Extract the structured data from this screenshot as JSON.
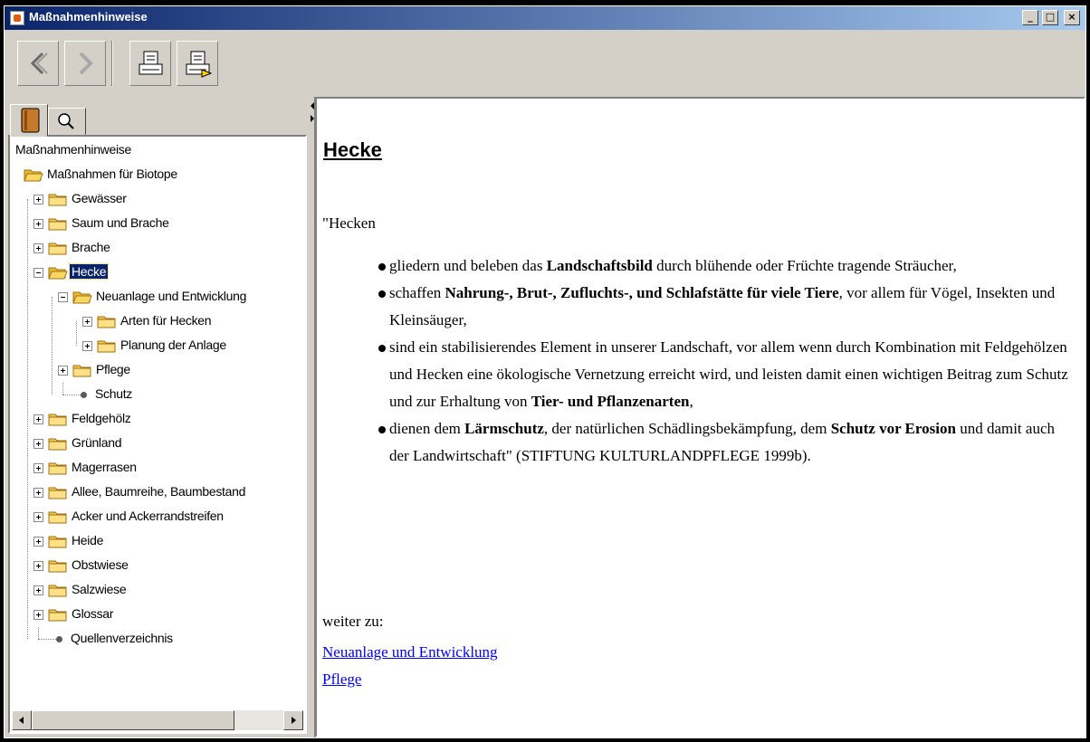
{
  "window": {
    "title": "Maßnahmenhinweise",
    "minimize": "_",
    "maximize": "□",
    "close": "×"
  },
  "tree": [
    {
      "label": "Maßnahmenhinweise",
      "depth": 0,
      "kind": "root"
    },
    {
      "label": "Maßnahmen für Biotope",
      "depth": 0,
      "kind": "folder-open"
    },
    {
      "label": "Gewässer",
      "depth": 1,
      "kind": "folder",
      "exp": "plus"
    },
    {
      "label": "Saum und Brache",
      "depth": 1,
      "kind": "folder",
      "exp": "plus"
    },
    {
      "label": "Brache",
      "depth": 1,
      "kind": "folder",
      "exp": "plus"
    },
    {
      "label": "Hecke",
      "depth": 1,
      "kind": "folder-open",
      "exp": "minus",
      "selected": true
    },
    {
      "label": "Neuanlage und Entwicklung",
      "depth": 2,
      "kind": "folder-open",
      "exp": "minus"
    },
    {
      "label": "Arten für Hecken",
      "depth": 3,
      "kind": "folder",
      "exp": "plus"
    },
    {
      "label": "Planung der Anlage",
      "depth": 3,
      "kind": "folder",
      "exp": "plus"
    },
    {
      "label": "Pflege",
      "depth": 2,
      "kind": "folder",
      "exp": "plus"
    },
    {
      "label": "Schutz",
      "depth": 2,
      "kind": "leaf"
    },
    {
      "label": "Feldgehölz",
      "depth": 1,
      "kind": "folder",
      "exp": "plus"
    },
    {
      "label": "Grünland",
      "depth": 1,
      "kind": "folder",
      "exp": "plus"
    },
    {
      "label": "Magerrasen",
      "depth": 1,
      "kind": "folder",
      "exp": "plus"
    },
    {
      "label": "Allee, Baumreihe, Baumbestand",
      "depth": 1,
      "kind": "folder",
      "exp": "plus"
    },
    {
      "label": "Acker und Ackerrandstreifen",
      "depth": 1,
      "kind": "folder",
      "exp": "plus"
    },
    {
      "label": "Heide",
      "depth": 1,
      "kind": "folder",
      "exp": "plus"
    },
    {
      "label": "Obstwiese",
      "depth": 1,
      "kind": "folder",
      "exp": "plus"
    },
    {
      "label": "Salzwiese",
      "depth": 1,
      "kind": "folder",
      "exp": "plus"
    },
    {
      "label": "Glossar",
      "depth": 1,
      "kind": "folder",
      "exp": "plus"
    },
    {
      "label": "Quellenverzeichnis",
      "depth": 1,
      "kind": "leaf"
    }
  ],
  "content": {
    "heading": "Hecke",
    "intro": "\"Hecken",
    "bullets": [
      [
        {
          "t": "gliedern und beleben das "
        },
        {
          "t": "Landschaftsbild",
          "b": true
        },
        {
          "t": " durch blühende oder Früchte tragende Sträucher,"
        }
      ],
      [
        {
          "t": "schaffen "
        },
        {
          "t": "Nahrung-, Brut-, Zufluchts-, und Schlafstätte für viele Tiere",
          "b": true
        },
        {
          "t": ", vor allem für Vögel, Insekten und Kleinsäuger,"
        }
      ],
      [
        {
          "t": "sind ein stabilisierendes Element in unserer Landschaft, vor allem wenn durch Kombination mit Feldgehölzen und Hecken eine ökologische Vernetzung erreicht wird, und leisten damit einen wichtigen Beitrag zum Schutz und zur Erhaltung von "
        },
        {
          "t": "Tier- und Pflanzenarten",
          "b": true
        },
        {
          "t": ","
        }
      ],
      [
        {
          "t": "dienen dem "
        },
        {
          "t": "Lärmschutz",
          "b": true
        },
        {
          "t": ", der natürlichen Schädlingsbekämpfung, dem "
        },
        {
          "t": "Schutz vor Erosion",
          "b": true
        },
        {
          "t": " und damit auch der Landwirtschaft\" (STIFTUNG KULTURLANDPFLEGE 1999b)."
        }
      ]
    ],
    "weiter_label": "weiter zu:",
    "links": [
      "Neuanlage und Entwicklung",
      "Pflege"
    ]
  }
}
